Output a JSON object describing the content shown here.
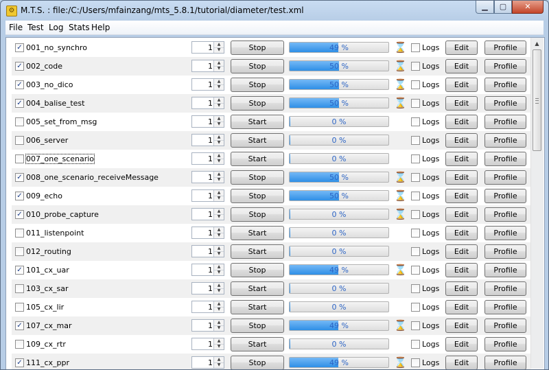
{
  "window": {
    "title": "M.T.S. : file:/C:/Users/mfainzang/mts_5.8.1/tutorial/diameter/test.xml",
    "min_label": "▁",
    "max_label": "▢",
    "close_label": "✕"
  },
  "menu": [
    "File",
    "Test",
    "Log",
    "Stats",
    "Help"
  ],
  "common": {
    "logs_label": "Logs",
    "edit_label": "Edit",
    "profile_label": "Profile",
    "checkmark": "✓",
    "up_arrow": "▲",
    "down_arrow": "▼",
    "hourglass": "⌛"
  },
  "tests": [
    {
      "name": "001_no_synchro",
      "checked": true,
      "count": "1",
      "run_label": "Stop",
      "progress_text": "49 %",
      "progress": 0.49,
      "running": true,
      "logs": false
    },
    {
      "name": "002_code",
      "checked": true,
      "count": "1",
      "run_label": "Stop",
      "progress_text": "50 %",
      "progress": 0.5,
      "running": true,
      "logs": false
    },
    {
      "name": "003_no_dico",
      "checked": true,
      "count": "1",
      "run_label": "Stop",
      "progress_text": "50 %",
      "progress": 0.5,
      "running": true,
      "logs": false
    },
    {
      "name": "004_balise_test",
      "checked": true,
      "count": "1",
      "run_label": "Stop",
      "progress_text": "50 %",
      "progress": 0.5,
      "running": true,
      "logs": false
    },
    {
      "name": "005_set_from_msg",
      "checked": false,
      "count": "1",
      "run_label": "Start",
      "progress_text": "0 %",
      "progress": 0.0,
      "running": false,
      "logs": false
    },
    {
      "name": "006_server",
      "checked": false,
      "count": "1",
      "run_label": "Start",
      "progress_text": "0 %",
      "progress": 0.0,
      "running": false,
      "logs": false
    },
    {
      "name": "007_one_scenario",
      "checked": false,
      "count": "1",
      "run_label": "Start",
      "progress_text": "0 %",
      "progress": 0.0,
      "running": false,
      "logs": false,
      "focused": true
    },
    {
      "name": "008_one_scenario_receiveMessage",
      "checked": true,
      "count": "1",
      "run_label": "Stop",
      "progress_text": "50 %",
      "progress": 0.5,
      "running": true,
      "logs": false
    },
    {
      "name": "009_echo",
      "checked": true,
      "count": "1",
      "run_label": "Stop",
      "progress_text": "50 %",
      "progress": 0.5,
      "running": true,
      "logs": false
    },
    {
      "name": "010_probe_capture",
      "checked": true,
      "count": "1",
      "run_label": "Stop",
      "progress_text": "0 %",
      "progress": 0.0,
      "running": true,
      "logs": false
    },
    {
      "name": "011_listenpoint",
      "checked": false,
      "count": "1",
      "run_label": "Start",
      "progress_text": "0 %",
      "progress": 0.0,
      "running": false,
      "logs": false
    },
    {
      "name": "012_routing",
      "checked": false,
      "count": "1",
      "run_label": "Start",
      "progress_text": "0 %",
      "progress": 0.0,
      "running": false,
      "logs": false
    },
    {
      "name": "101_cx_uar",
      "checked": true,
      "count": "1",
      "run_label": "Stop",
      "progress_text": "49 %",
      "progress": 0.49,
      "running": true,
      "logs": false
    },
    {
      "name": "103_cx_sar",
      "checked": false,
      "count": "1",
      "run_label": "Start",
      "progress_text": "0 %",
      "progress": 0.0,
      "running": false,
      "logs": false
    },
    {
      "name": "105_cx_lir",
      "checked": false,
      "count": "1",
      "run_label": "Start",
      "progress_text": "0 %",
      "progress": 0.0,
      "running": false,
      "logs": false
    },
    {
      "name": "107_cx_mar",
      "checked": true,
      "count": "1",
      "run_label": "Stop",
      "progress_text": "49 %",
      "progress": 0.49,
      "running": true,
      "logs": false
    },
    {
      "name": "109_cx_rtr",
      "checked": false,
      "count": "1",
      "run_label": "Start",
      "progress_text": "0 %",
      "progress": 0.0,
      "running": false,
      "logs": false
    },
    {
      "name": "111_cx_ppr",
      "checked": true,
      "count": "1",
      "run_label": "Stop",
      "progress_text": "49 %",
      "progress": 0.49,
      "running": true,
      "logs": false
    }
  ]
}
